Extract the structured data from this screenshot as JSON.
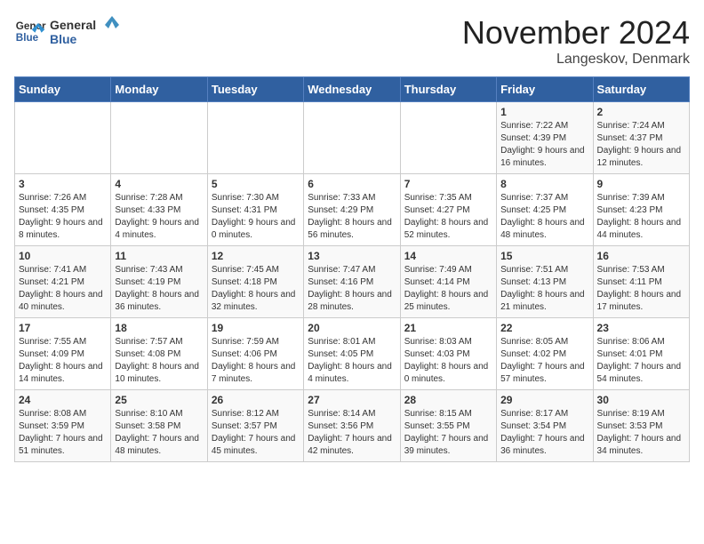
{
  "header": {
    "logo_general": "General",
    "logo_blue": "Blue",
    "title": "November 2024",
    "subtitle": "Langeskov, Denmark"
  },
  "columns": [
    "Sunday",
    "Monday",
    "Tuesday",
    "Wednesday",
    "Thursday",
    "Friday",
    "Saturday"
  ],
  "weeks": [
    [
      {
        "day": "",
        "info": ""
      },
      {
        "day": "",
        "info": ""
      },
      {
        "day": "",
        "info": ""
      },
      {
        "day": "",
        "info": ""
      },
      {
        "day": "",
        "info": ""
      },
      {
        "day": "1",
        "info": "Sunrise: 7:22 AM\nSunset: 4:39 PM\nDaylight: 9 hours and 16 minutes."
      },
      {
        "day": "2",
        "info": "Sunrise: 7:24 AM\nSunset: 4:37 PM\nDaylight: 9 hours and 12 minutes."
      }
    ],
    [
      {
        "day": "3",
        "info": "Sunrise: 7:26 AM\nSunset: 4:35 PM\nDaylight: 9 hours and 8 minutes."
      },
      {
        "day": "4",
        "info": "Sunrise: 7:28 AM\nSunset: 4:33 PM\nDaylight: 9 hours and 4 minutes."
      },
      {
        "day": "5",
        "info": "Sunrise: 7:30 AM\nSunset: 4:31 PM\nDaylight: 9 hours and 0 minutes."
      },
      {
        "day": "6",
        "info": "Sunrise: 7:33 AM\nSunset: 4:29 PM\nDaylight: 8 hours and 56 minutes."
      },
      {
        "day": "7",
        "info": "Sunrise: 7:35 AM\nSunset: 4:27 PM\nDaylight: 8 hours and 52 minutes."
      },
      {
        "day": "8",
        "info": "Sunrise: 7:37 AM\nSunset: 4:25 PM\nDaylight: 8 hours and 48 minutes."
      },
      {
        "day": "9",
        "info": "Sunrise: 7:39 AM\nSunset: 4:23 PM\nDaylight: 8 hours and 44 minutes."
      }
    ],
    [
      {
        "day": "10",
        "info": "Sunrise: 7:41 AM\nSunset: 4:21 PM\nDaylight: 8 hours and 40 minutes."
      },
      {
        "day": "11",
        "info": "Sunrise: 7:43 AM\nSunset: 4:19 PM\nDaylight: 8 hours and 36 minutes."
      },
      {
        "day": "12",
        "info": "Sunrise: 7:45 AM\nSunset: 4:18 PM\nDaylight: 8 hours and 32 minutes."
      },
      {
        "day": "13",
        "info": "Sunrise: 7:47 AM\nSunset: 4:16 PM\nDaylight: 8 hours and 28 minutes."
      },
      {
        "day": "14",
        "info": "Sunrise: 7:49 AM\nSunset: 4:14 PM\nDaylight: 8 hours and 25 minutes."
      },
      {
        "day": "15",
        "info": "Sunrise: 7:51 AM\nSunset: 4:13 PM\nDaylight: 8 hours and 21 minutes."
      },
      {
        "day": "16",
        "info": "Sunrise: 7:53 AM\nSunset: 4:11 PM\nDaylight: 8 hours and 17 minutes."
      }
    ],
    [
      {
        "day": "17",
        "info": "Sunrise: 7:55 AM\nSunset: 4:09 PM\nDaylight: 8 hours and 14 minutes."
      },
      {
        "day": "18",
        "info": "Sunrise: 7:57 AM\nSunset: 4:08 PM\nDaylight: 8 hours and 10 minutes."
      },
      {
        "day": "19",
        "info": "Sunrise: 7:59 AM\nSunset: 4:06 PM\nDaylight: 8 hours and 7 minutes."
      },
      {
        "day": "20",
        "info": "Sunrise: 8:01 AM\nSunset: 4:05 PM\nDaylight: 8 hours and 4 minutes."
      },
      {
        "day": "21",
        "info": "Sunrise: 8:03 AM\nSunset: 4:03 PM\nDaylight: 8 hours and 0 minutes."
      },
      {
        "day": "22",
        "info": "Sunrise: 8:05 AM\nSunset: 4:02 PM\nDaylight: 7 hours and 57 minutes."
      },
      {
        "day": "23",
        "info": "Sunrise: 8:06 AM\nSunset: 4:01 PM\nDaylight: 7 hours and 54 minutes."
      }
    ],
    [
      {
        "day": "24",
        "info": "Sunrise: 8:08 AM\nSunset: 3:59 PM\nDaylight: 7 hours and 51 minutes."
      },
      {
        "day": "25",
        "info": "Sunrise: 8:10 AM\nSunset: 3:58 PM\nDaylight: 7 hours and 48 minutes."
      },
      {
        "day": "26",
        "info": "Sunrise: 8:12 AM\nSunset: 3:57 PM\nDaylight: 7 hours and 45 minutes."
      },
      {
        "day": "27",
        "info": "Sunrise: 8:14 AM\nSunset: 3:56 PM\nDaylight: 7 hours and 42 minutes."
      },
      {
        "day": "28",
        "info": "Sunrise: 8:15 AM\nSunset: 3:55 PM\nDaylight: 7 hours and 39 minutes."
      },
      {
        "day": "29",
        "info": "Sunrise: 8:17 AM\nSunset: 3:54 PM\nDaylight: 7 hours and 36 minutes."
      },
      {
        "day": "30",
        "info": "Sunrise: 8:19 AM\nSunset: 3:53 PM\nDaylight: 7 hours and 34 minutes."
      }
    ]
  ]
}
